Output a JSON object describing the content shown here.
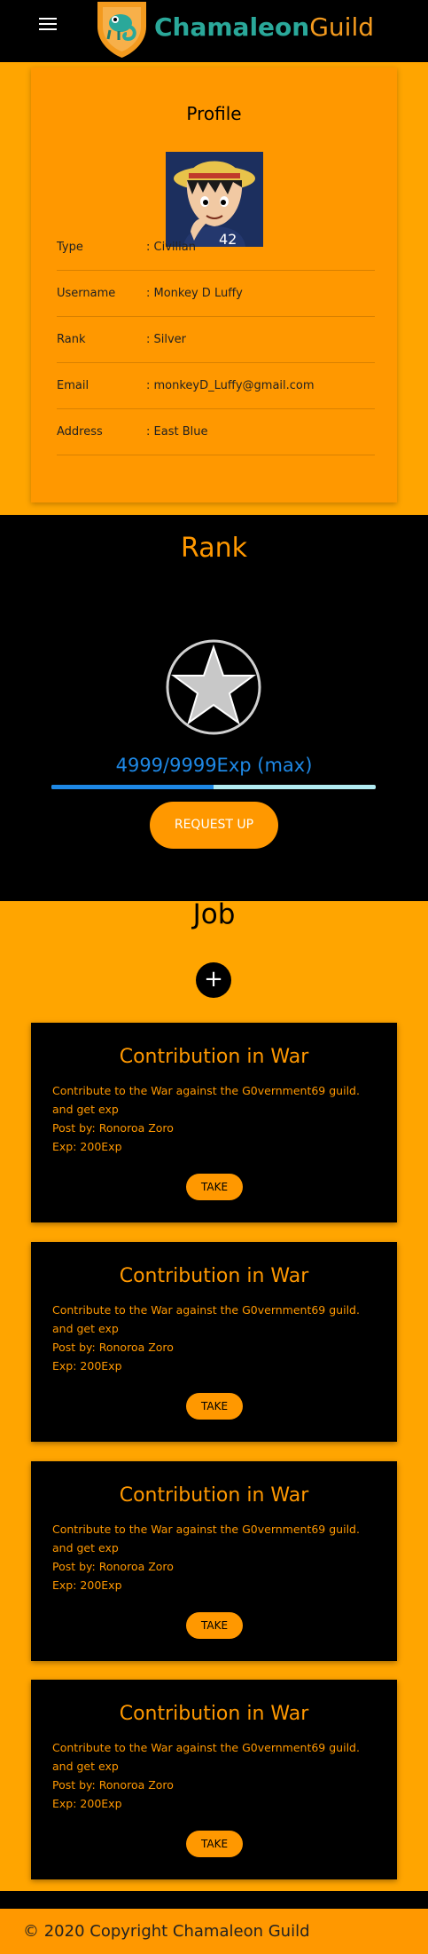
{
  "header": {
    "brand_part1": "Chamaleon",
    "brand_part2": "Guild",
    "menu_icon": "hamburger-menu-icon",
    "logo_icon": "chameleon-shield-logo"
  },
  "profile": {
    "title": "Profile",
    "avatar_icon": "profile-avatar-image",
    "fields": [
      {
        "label": "Type",
        "value": ": Civilian"
      },
      {
        "label": "Username",
        "value": ": Monkey D Luffy"
      },
      {
        "label": "Rank",
        "value": ": Silver"
      },
      {
        "label": "Email",
        "value": ": monkeyD_Luffy@gmail.com"
      },
      {
        "label": "Address",
        "value": ": East Blue"
      }
    ]
  },
  "rank": {
    "title": "Rank",
    "badge_icon": "star-badge-icon",
    "exp_text": "4999/9999Exp (max)",
    "exp_progress": 0.5,
    "request_label": "REQUEST UP"
  },
  "jobs": {
    "title": "Job",
    "add_label": "+",
    "items": [
      {
        "title": "Contribution in War",
        "description": "Contribute to the War against the G0vernment69 guild. and get exp",
        "post_by": "Post by: Ronoroa Zoro",
        "exp": "Exp: 200Exp",
        "take_label": "TAKE"
      },
      {
        "title": "Contribution in War",
        "description": "Contribute to the War against the G0vernment69 guild. and get exp",
        "post_by": "Post by: Ronoroa Zoro",
        "exp": "Exp: 200Exp",
        "take_label": "TAKE"
      },
      {
        "title": "Contribution in War",
        "description": "Contribute to the War against the G0vernment69 guild. and get exp",
        "post_by": "Post by: Ronoroa Zoro",
        "exp": "Exp: 200Exp",
        "take_label": "TAKE"
      },
      {
        "title": "Contribution in War",
        "description": "Contribute to the War against the G0vernment69 guild. and get exp",
        "post_by": "Post by: Ronoroa Zoro",
        "exp": "Exp: 200Exp",
        "take_label": "TAKE"
      }
    ]
  },
  "footer": {
    "text": "© 2020 Copyright Chamaleon Guild"
  },
  "colors": {
    "accent": "#FF9800",
    "background": "#FFA500",
    "dark": "#000000",
    "exp_blue": "#1E88E5",
    "brand_teal": "#2AA89A"
  }
}
